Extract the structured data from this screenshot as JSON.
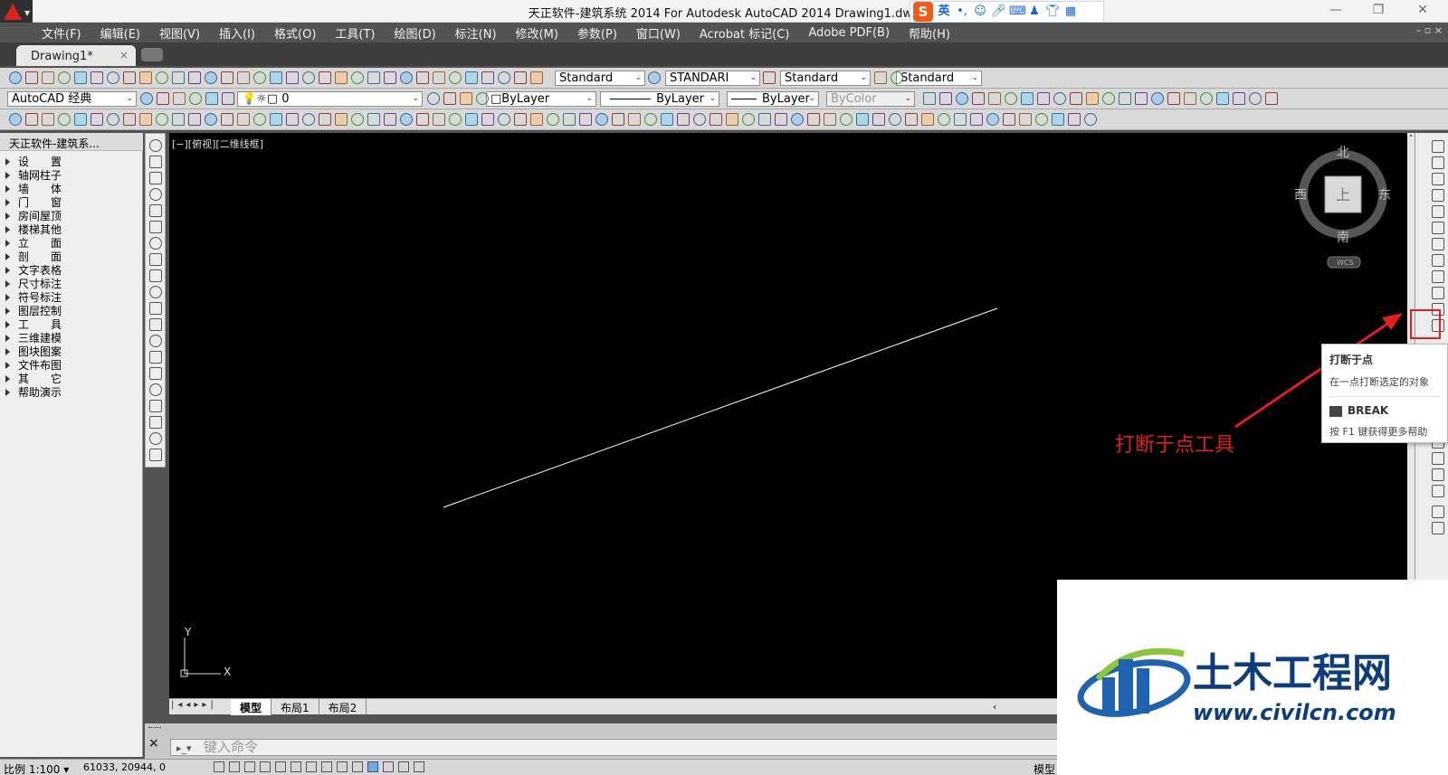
{
  "window": {
    "title": "天正软件-建筑系统 2014  For Autodesk AutoCAD 2014    Drawing1.dwg",
    "minimize_icon": "minimize-icon",
    "restore_icon": "restore-icon",
    "close_icon": "close-icon"
  },
  "ime": {
    "logo": "S",
    "lang": "英",
    "punct": "•,"
  },
  "menu": [
    "文件(F)",
    "编辑(E)",
    "视图(V)",
    "插入(I)",
    "格式(O)",
    "工具(T)",
    "绘图(D)",
    "标注(N)",
    "修改(M)",
    "参数(P)",
    "窗口(W)",
    "Acrobat 标记(C)",
    "Adobe PDF(B)",
    "帮助(H)"
  ],
  "menu_controls": "– ▫ ×",
  "doc_tab": {
    "label": "Drawing1*",
    "close": "×"
  },
  "toolbar1": {
    "text_style": "Standard",
    "dim_style": "STANDARI",
    "table_style": "Standard",
    "multileader_style": "Standard"
  },
  "toolbar2": {
    "workspace": "AutoCAD 经典",
    "layer": "0",
    "color": "ByLayer",
    "linetype": "ByLayer",
    "lineweight": "ByLayer",
    "plotstyle": "ByColor"
  },
  "left_panel": {
    "title": "天正软件-建筑系...",
    "items": [
      "设　　置",
      "轴网柱子",
      "墙　　体",
      "门　　窗",
      "房间屋顶",
      "楼梯其他",
      "立　　面",
      "剖　　面",
      "文字表格",
      "尺寸标注",
      "符号标注",
      "图层控制",
      "工　　具",
      "三维建模",
      "图块图案",
      "文件布图",
      "其　　它",
      "帮助演示"
    ]
  },
  "viewport": {
    "label": "[−][俯视][二维线框]",
    "viewcube": {
      "north": "北",
      "south": "南",
      "east": "东",
      "west": "西",
      "top": "上",
      "wcs": "WCS"
    },
    "ucs": {
      "x": "X",
      "y": "Y"
    }
  },
  "tooltip": {
    "title": "打断于点",
    "description": "在一点打断选定的对象",
    "command": "BREAK",
    "help": "按 F1 键获得更多帮助"
  },
  "annotation": {
    "text": "打断于点工具",
    "color": "#e02020"
  },
  "layout_tabs": [
    "模型",
    "布局1",
    "布局2"
  ],
  "command": {
    "placeholder": "键入命令",
    "close": "×"
  },
  "status": {
    "scale": "比例 1:100",
    "coords": "61033, 20944, 0",
    "model": "模型"
  },
  "watermark": {
    "site_name": "土木工程网",
    "url": "www.civilcn.com"
  },
  "colors": {
    "canvas": "#000000",
    "ui_dark": "#535353",
    "toolbar": "#d9d9d9",
    "accent_red": "#e02020"
  }
}
